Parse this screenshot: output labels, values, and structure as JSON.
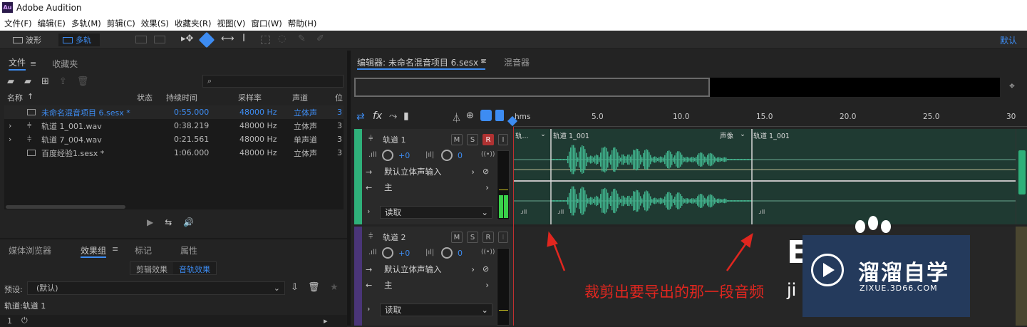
{
  "app": {
    "title": "Adobe Audition",
    "logo": "Au"
  },
  "menu": [
    "文件(F)",
    "编辑(E)",
    "多轨(M)",
    "剪辑(C)",
    "效果(S)",
    "收藏夹(R)",
    "视图(V)",
    "窗口(W)",
    "帮助(H)"
  ],
  "toolbar": {
    "waveform_label": "波形",
    "multitrack_label": "多轨",
    "workspace_label": "默认"
  },
  "files_panel": {
    "tabs": [
      "文件",
      "收藏夹"
    ],
    "columns": [
      "名称",
      "状态",
      "持续时间",
      "采样率",
      "声道",
      "位"
    ],
    "rows": [
      {
        "name": "未命名混音项目 6.sesx *",
        "duration": "0:55.000",
        "rate": "48000 Hz",
        "channels": "立体声",
        "bits": "3"
      },
      {
        "name": "轨道 1_001.wav",
        "duration": "0:38.219",
        "rate": "48000 Hz",
        "channels": "立体声",
        "bits": "3"
      },
      {
        "name": "轨道 7_004.wav",
        "duration": "0:21.561",
        "rate": "48000 Hz",
        "channels": "单声道",
        "bits": "3"
      },
      {
        "name": "百度经验1.sesx *",
        "duration": "1:06.000",
        "rate": "48000 Hz",
        "channels": "立体声",
        "bits": "3"
      }
    ]
  },
  "effects_panel": {
    "tabs": [
      "媒体浏览器",
      "效果组",
      "标记",
      "属性"
    ],
    "subtabs": [
      "剪辑效果",
      "音轨效果"
    ],
    "preset_label": "预设:",
    "preset_value": "(默认)",
    "track_label": "轨道:轨道 1",
    "slot_number": "1"
  },
  "editor": {
    "tab_label": "编辑器: 未命名混音项目 6.sesx *",
    "mixer_label": "混音器",
    "fx_label": "fx",
    "ruler": [
      "hms",
      "5.0",
      "10.0",
      "15.0",
      "20.0",
      "25.0",
      "30"
    ]
  },
  "tracks": [
    {
      "name": "轨道 1",
      "volume": "+0",
      "pan": "0",
      "input": "默认立体声输入",
      "output": "主",
      "automation": "读取",
      "m": "M",
      "s": "S",
      "r": "R",
      "i": "I"
    },
    {
      "name": "轨道 2",
      "volume": "+0",
      "pan": "0",
      "input": "默认立体声输入",
      "output": "主",
      "automation": "读取",
      "m": "M",
      "s": "S",
      "r": "R",
      "i": "I"
    }
  ],
  "clips": {
    "left_label": "轨...",
    "clip1_label": "轨道 1_001",
    "pan_label": "声像",
    "clip2_label": "轨道 1_001"
  },
  "annotation": "裁剪出要导出的那一段音频",
  "watermark": {
    "brand": "溜溜自学",
    "url": "ZIXUE.3D66.COM",
    "partial_e": "E",
    "partial_ji": "ji"
  },
  "colors": {
    "accent": "#3d8cf2",
    "wave": "#3fb08a",
    "track1": "#2fb07a",
    "track2": "#5a3a8c",
    "annotation": "#e0261f"
  }
}
